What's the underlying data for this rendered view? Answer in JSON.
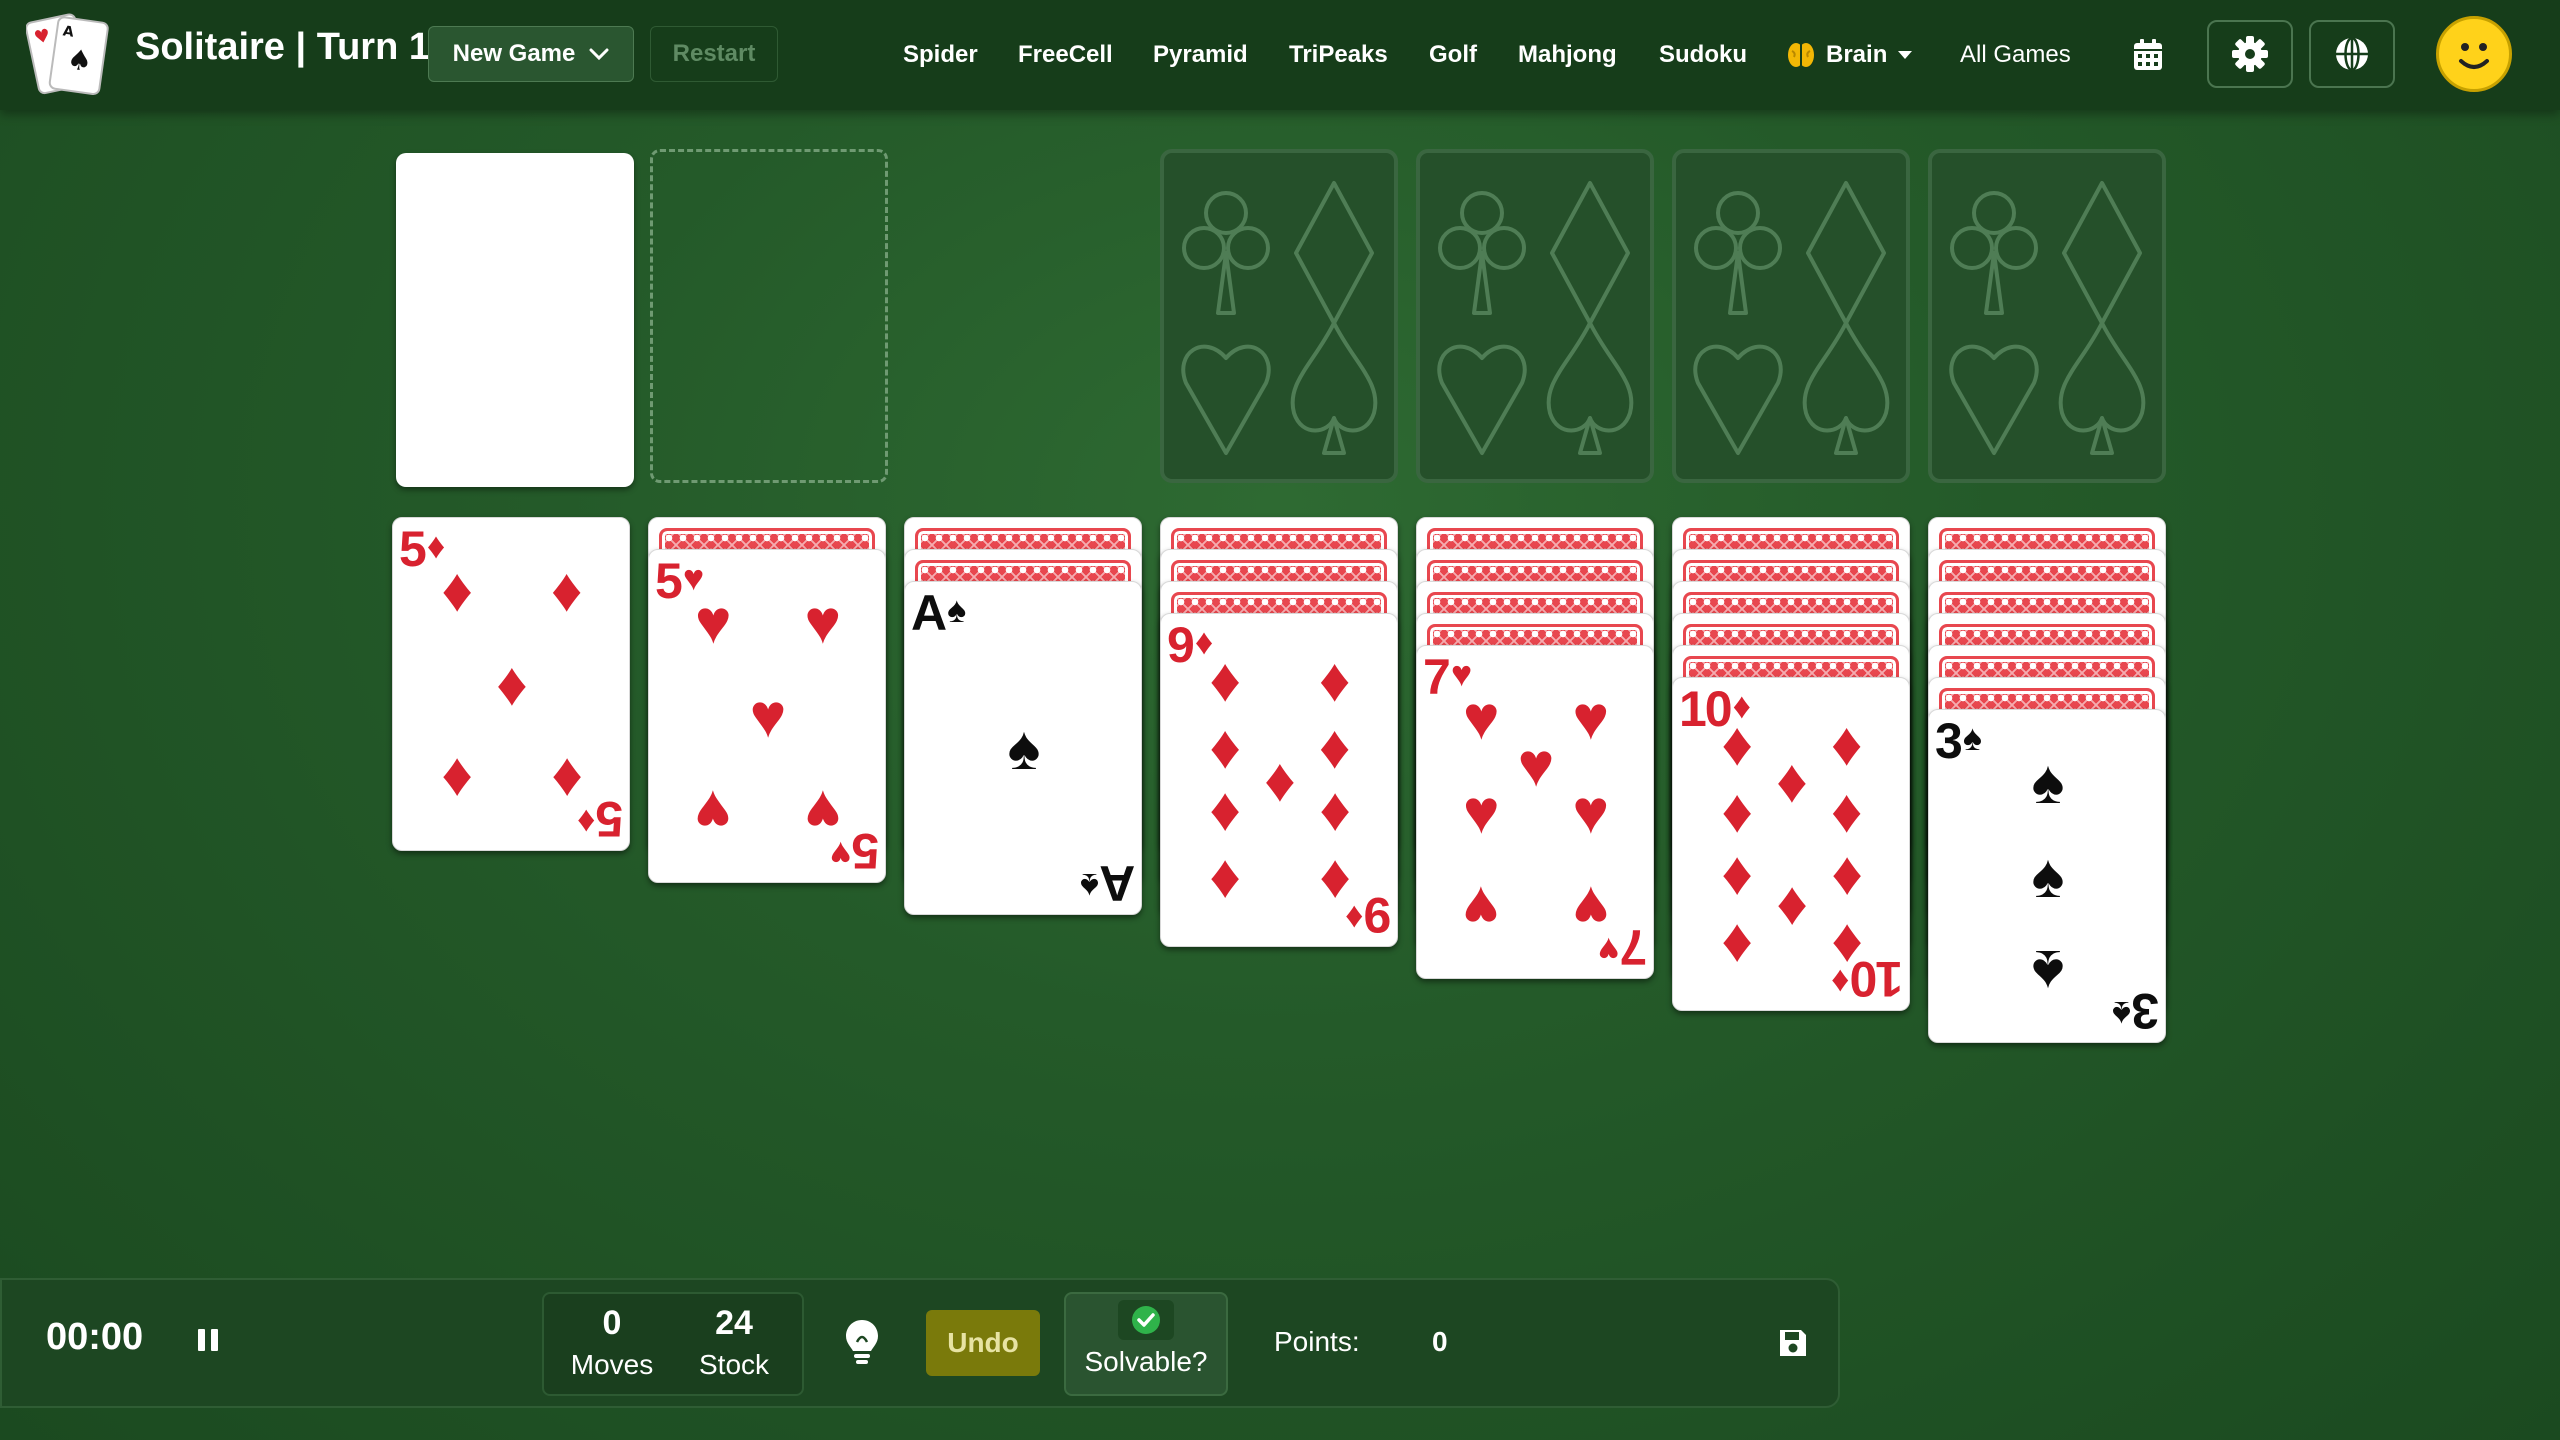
{
  "header": {
    "title": "Solitaire | Turn 1",
    "new_game_label": "New Game",
    "restart_label": "Restart",
    "nav": [
      "Spider",
      "FreeCell",
      "Pyramid",
      "TriPeaks",
      "Golf",
      "Mahjong",
      "Sudoku"
    ],
    "brain_label": "Brain",
    "all_games_label": "All Games",
    "icons": [
      "calendar-icon",
      "gear-icon",
      "globe-icon",
      "smiley-avatar-icon"
    ]
  },
  "tableau": [
    {
      "hidden": 0,
      "rank": "5",
      "suit": "♦",
      "color": "red"
    },
    {
      "hidden": 1,
      "rank": "5",
      "suit": "♥",
      "color": "red"
    },
    {
      "hidden": 2,
      "rank": "A",
      "suit": "♠",
      "color": "black"
    },
    {
      "hidden": 3,
      "rank": "9",
      "suit": "♦",
      "color": "red"
    },
    {
      "hidden": 4,
      "rank": "7",
      "suit": "♥",
      "color": "red"
    },
    {
      "hidden": 5,
      "rank": "10",
      "suit": "♦",
      "color": "red"
    },
    {
      "hidden": 6,
      "rank": "3",
      "suit": "♠",
      "color": "black"
    }
  ],
  "footer": {
    "timer": "00:00",
    "moves_value": "0",
    "moves_label": "Moves",
    "stock_value": "24",
    "stock_label": "Stock",
    "undo_label": "Undo",
    "solvable_label": "Solvable?",
    "points_label": "Points:",
    "points_value": "0"
  },
  "colors": {
    "felt": "#245a29",
    "topbar": "#163d1a",
    "card_red": "#d8222f",
    "card_back": "#e8474f",
    "undo": "#7a7a0b"
  }
}
